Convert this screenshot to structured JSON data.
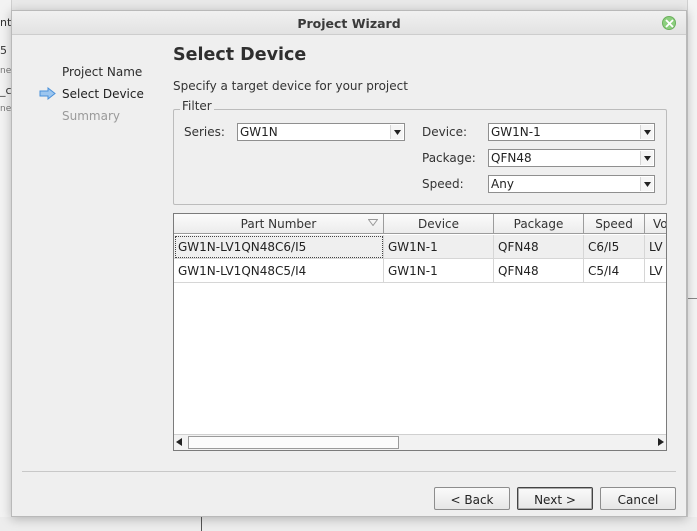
{
  "background": {
    "left_fragments": [
      "nt",
      "5",
      "ne",
      "_c",
      "ne"
    ]
  },
  "dialog": {
    "title": "Project Wizard",
    "close_icon": "close-icon",
    "steps": [
      {
        "label": "Project Name",
        "state": "done"
      },
      {
        "label": "Select Device",
        "state": "current"
      },
      {
        "label": "Summary",
        "state": "future"
      }
    ],
    "heading": "Select Device",
    "subtitle": "Specify a target device for your project",
    "filter": {
      "legend": "Filter",
      "series_label": "Series:",
      "series_value": "GW1N",
      "device_label": "Device:",
      "device_value": "GW1N-1",
      "package_label": "Package:",
      "package_value": "QFN48",
      "speed_label": "Speed:",
      "speed_value": "Any"
    },
    "table": {
      "columns": [
        "Part Number",
        "Device",
        "Package",
        "Speed",
        "Vo"
      ],
      "rows": [
        [
          "GW1N-LV1QN48C6/I5",
          "GW1N-1",
          "QFN48",
          "C6/I5",
          "LV"
        ],
        [
          "GW1N-LV1QN48C5/I4",
          "GW1N-1",
          "QFN48",
          "C5/I4",
          "LV"
        ]
      ]
    },
    "buttons": {
      "back": "< Back",
      "next": "Next >",
      "cancel": "Cancel"
    }
  },
  "colors": {
    "accent_arrow": "#4a90d9",
    "close_green": "#8ccf7e"
  }
}
